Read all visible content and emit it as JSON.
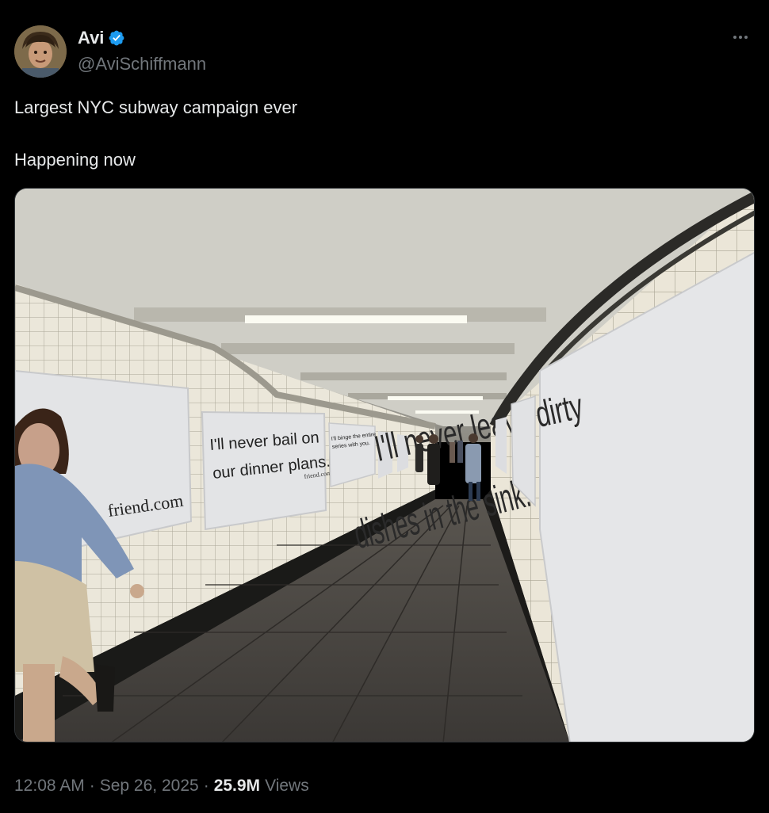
{
  "author": {
    "display_name": "Avi",
    "handle": "@AviSchiffmann",
    "verified": true,
    "verified_color": "#1d9bf0"
  },
  "tweet": {
    "lines": [
      "Largest NYC subway campaign ever",
      "Happening now"
    ]
  },
  "media": {
    "posters": {
      "left_main": "friend.com",
      "left_second_line1": "I'll never bail on",
      "left_second_line2": "our dinner plans.",
      "left_second_brand": "friend.com",
      "left_third_line1": "I'll binge the entire",
      "left_third_line2": "series with you.",
      "right_main_line1": "I'll never leave dirty",
      "right_main_line2": "dishes in the sink."
    }
  },
  "meta": {
    "time": "12:08 AM",
    "separator": "·",
    "date": "Sep 26, 2025",
    "views_count": "25.9M",
    "views_label": "Views"
  },
  "icons": {
    "more": "more-horizontal-icon",
    "verified": "verified-badge-icon"
  }
}
